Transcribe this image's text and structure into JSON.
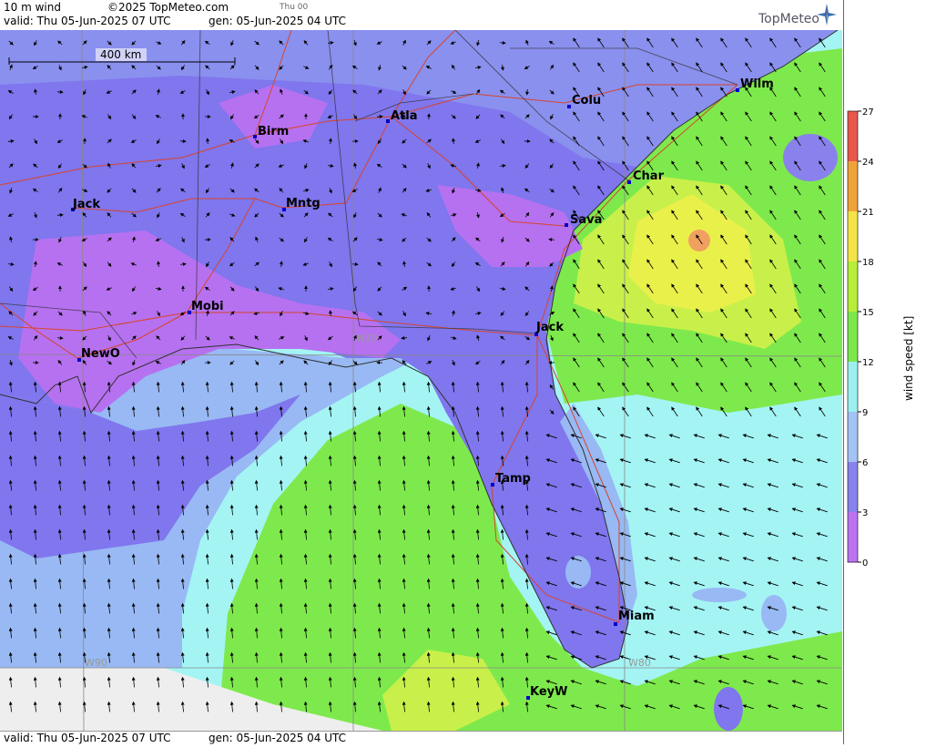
{
  "header": {
    "product": "10 m wind",
    "copyright": "©2025 TopMeteo.com",
    "valid": "valid:  Thu  05-Jun-2025  07 UTC",
    "gen": "gen:  05-Jun-2025 04 UTC",
    "run_label": "Thu 00",
    "logo": "TopMeteo"
  },
  "footer": {
    "valid": "valid:  Thu  05-Jun-2025  07 UTC",
    "gen": "gen:  05-Jun-2025 04 UTC"
  },
  "scale_bar": "400 km",
  "grid_labels": [
    "N30",
    "W90",
    "W80"
  ],
  "cities": [
    "Birm",
    "Atla",
    "Colu",
    "Wilm",
    "Char",
    "Sava",
    "Jack",
    "Mntg",
    "Mobi",
    "NewO",
    "Jack",
    "Tamp",
    "Miam",
    "KeyW"
  ],
  "legend": {
    "title": "wind speed [kt]",
    "ticks": [
      "27",
      "24",
      "21",
      "18",
      "15",
      "12",
      "9",
      "6",
      "3",
      "0"
    ],
    "colors": [
      "#e8574a",
      "#f0a23a",
      "#f4e447",
      "#b7ee3a",
      "#7de84a",
      "#9df0f0",
      "#a3c3f5",
      "#8a82ec",
      "#bb73f1"
    ]
  },
  "colors": {
    "calm_violet": "#b671f0",
    "light_blue_violet": "#8076ee",
    "sky_blue": "#98b9f3",
    "cyan": "#a4f4f4",
    "green": "#7ee94c",
    "yellow_green": "#c9f04a",
    "yellow": "#eaf04a",
    "orange": "#f08a4a",
    "roads": "#e04a30",
    "borders": "#404040",
    "no_data": "#eeeeee"
  }
}
